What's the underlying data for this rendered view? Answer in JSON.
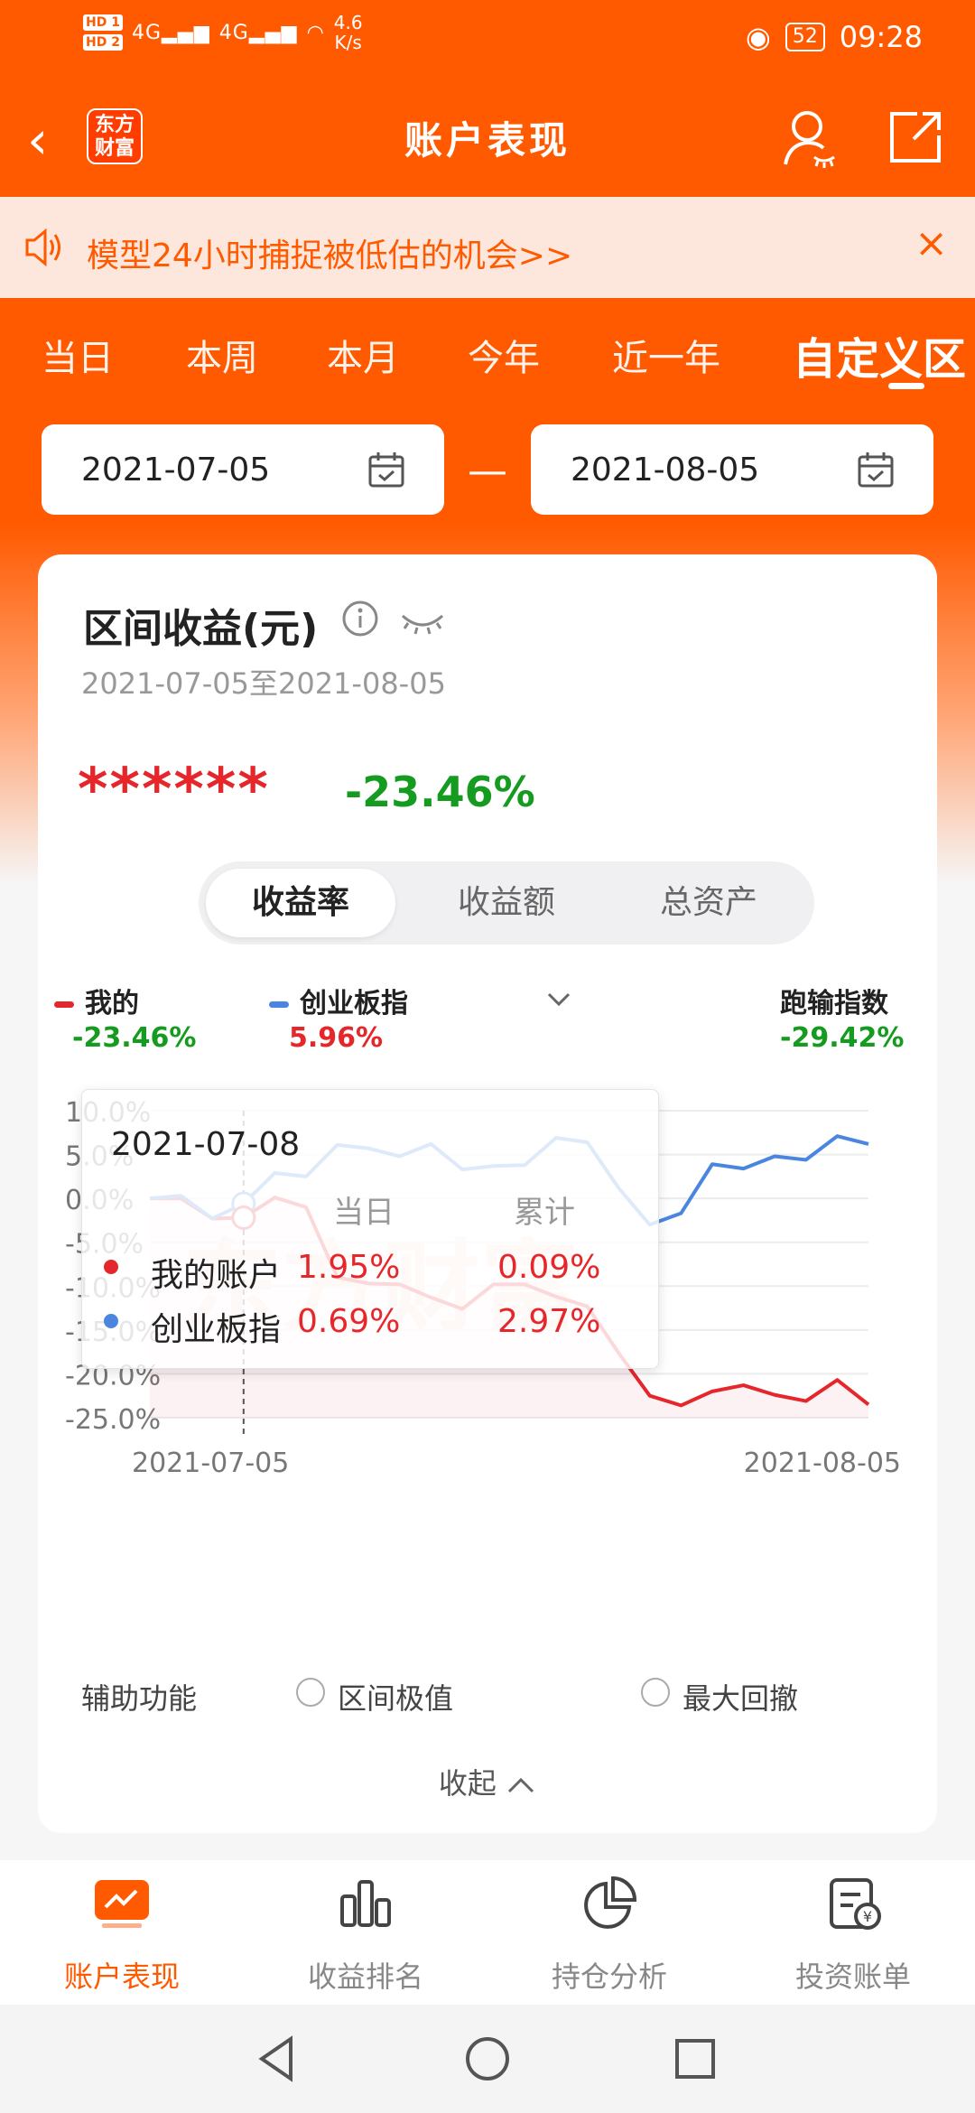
{
  "status_bar": {
    "hd1": "HD 1",
    "hd2": "HD 2",
    "signal1": "4G",
    "signal2": "4G",
    "speed_value": "4.6",
    "speed_unit": "K/s",
    "battery": "52",
    "time": "09:28"
  },
  "header": {
    "logo_line1": "东方",
    "logo_line2": "财富",
    "title": "账户表现"
  },
  "banner": {
    "text": "模型24小时捕捉被低估的机会>>",
    "close": "×"
  },
  "tabs": [
    {
      "label": "当日"
    },
    {
      "label": "本周"
    },
    {
      "label": "本月"
    },
    {
      "label": "今年"
    },
    {
      "label": "近一年"
    },
    {
      "label": "自定义区"
    }
  ],
  "date_range": {
    "start": "2021-07-05",
    "separator": "—",
    "end": "2021-08-05"
  },
  "card": {
    "title": "区间收益(元)",
    "subtitle": "2021-07-05至2021-08-05",
    "masked_amount": "******",
    "return_rate": "-23.46%",
    "segments": [
      "收益率",
      "收益额",
      "总资产"
    ],
    "legend": [
      {
        "name": "我的",
        "value": "-23.46%"
      },
      {
        "name": "创业板指",
        "value": "5.96%"
      },
      {
        "name": "跑输指数",
        "value": "-29.42%"
      }
    ],
    "aux_label": "辅助功能",
    "aux_options": [
      "区间极值",
      "最大回撤"
    ],
    "collapse_label": "收起"
  },
  "colors": {
    "brand": "#ff5a00",
    "mine": "#e5272c",
    "index": "#4a86e0",
    "negative": "#159b1f"
  },
  "chart_data": {
    "type": "line",
    "watermark": "东方财富",
    "x_start_label": "2021-07-05",
    "x_end_label": "2021-08-05",
    "y_ticks": [
      "10.0%",
      "5.0%",
      "0.0%",
      "-5.0%",
      "-10.0%",
      "-15.0%",
      "-20.0%",
      "-25.0%"
    ],
    "ylim": [
      -25,
      10
    ],
    "series": [
      {
        "name": "我的账户",
        "values": [
          0.0,
          0.0,
          -2.3,
          -2.2,
          0.1,
          -1.0,
          -9.0,
          -9.7,
          -9.8,
          -11.3,
          -12.6,
          -9.8,
          -9.8,
          -11.2,
          -12.3,
          -17.6,
          -22.5,
          -23.6,
          -22.0,
          -21.3,
          -22.4,
          -23.1,
          -20.7,
          -23.5
        ]
      },
      {
        "name": "创业板指",
        "values": [
          0.0,
          0.3,
          -2.3,
          -0.6,
          2.9,
          2.5,
          6.1,
          5.7,
          4.8,
          6.2,
          3.3,
          3.7,
          3.8,
          6.9,
          6.4,
          1.2,
          -3.0,
          -1.7,
          3.9,
          3.4,
          4.8,
          4.4,
          7.1,
          6.2
        ]
      }
    ],
    "tooltip": {
      "date": "2021-07-08",
      "col_day": "当日",
      "col_total": "累计",
      "rows": [
        {
          "name": "我的账户",
          "day": "1.95%",
          "total": "0.09%"
        },
        {
          "name": "创业板指",
          "day": "0.69%",
          "total": "2.97%"
        }
      ]
    }
  },
  "bottom_nav": [
    {
      "label": "账户表现"
    },
    {
      "label": "收益排名"
    },
    {
      "label": "持仓分析"
    },
    {
      "label": "投资账单"
    }
  ]
}
